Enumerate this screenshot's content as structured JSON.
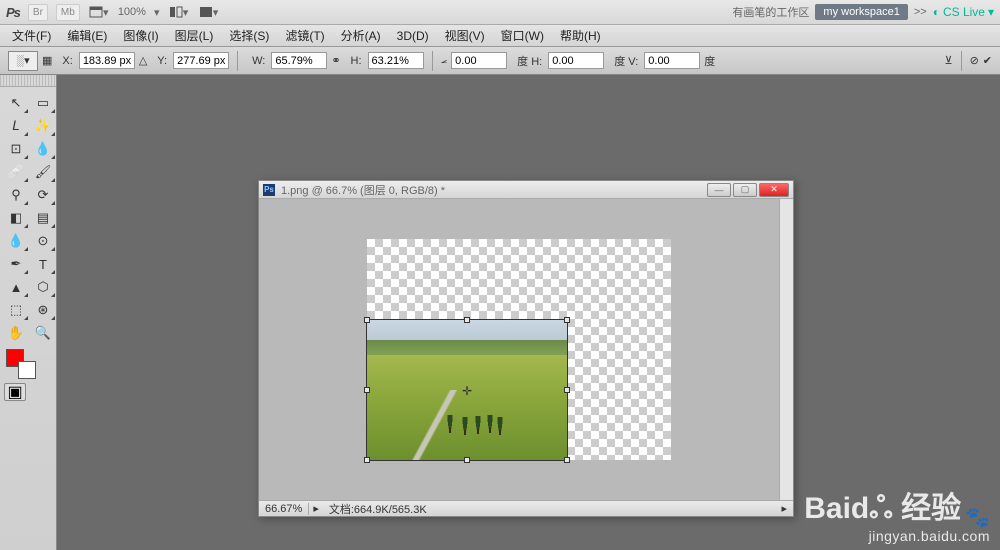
{
  "topbar": {
    "logo": "Ps",
    "buttons": [
      "Br",
      "Mb"
    ],
    "zoom": "100%",
    "workspace_text": "有画笔的工作区",
    "workspace_btn": "my workspace1",
    "nav_arrows": ">>",
    "cslive": "CS Live"
  },
  "menubar": [
    "文件(F)",
    "编辑(E)",
    "图像(I)",
    "图层(L)",
    "选择(S)",
    "滤镜(T)",
    "分析(A)",
    "3D(D)",
    "视图(V)",
    "窗口(W)",
    "帮助(H)"
  ],
  "optbar": {
    "x_label": "X:",
    "x_value": "183.89 px",
    "y_label": "Y:",
    "y_value": "277.69 px",
    "w_label": "W:",
    "w_value": "65.79%",
    "h_label": "H:",
    "h_value": "63.21%",
    "angle_value": "0.00",
    "h2_label": "度   H:",
    "h2_value": "0.00",
    "v_label": "度   V:",
    "v_value": "0.00",
    "v_unit": "度"
  },
  "tools": [
    {
      "name": "move-tool",
      "glyph": "↖",
      "fly": true
    },
    {
      "name": "marquee-tool",
      "glyph": "▭",
      "fly": true
    },
    {
      "name": "lasso-tool",
      "glyph": "𝘓",
      "fly": true
    },
    {
      "name": "wand-tool",
      "glyph": "✨",
      "fly": true
    },
    {
      "name": "crop-tool",
      "glyph": "⊡",
      "fly": true
    },
    {
      "name": "eyedropper-tool",
      "glyph": "💧",
      "fly": true
    },
    {
      "name": "healing-tool",
      "glyph": "🩹",
      "fly": true
    },
    {
      "name": "brush-tool",
      "glyph": "🖌",
      "fly": true
    },
    {
      "name": "stamp-tool",
      "glyph": "⚲",
      "fly": true
    },
    {
      "name": "history-brush-tool",
      "glyph": "⟳",
      "fly": true
    },
    {
      "name": "eraser-tool",
      "glyph": "◧",
      "fly": true
    },
    {
      "name": "gradient-tool",
      "glyph": "▤",
      "fly": true
    },
    {
      "name": "blur-tool",
      "glyph": "💧",
      "fly": true
    },
    {
      "name": "dodge-tool",
      "glyph": "⊙",
      "fly": true
    },
    {
      "name": "pen-tool",
      "glyph": "✒",
      "fly": true
    },
    {
      "name": "type-tool",
      "glyph": "T",
      "fly": true
    },
    {
      "name": "path-select-tool",
      "glyph": "▲",
      "fly": true
    },
    {
      "name": "shape-tool",
      "glyph": "⬡",
      "fly": true
    },
    {
      "name": "3d-tool",
      "glyph": "⬚",
      "fly": true
    },
    {
      "name": "3d-camera-tool",
      "glyph": "⊛",
      "fly": true
    },
    {
      "name": "hand-tool",
      "glyph": "✋",
      "fly": false
    },
    {
      "name": "zoom-tool",
      "glyph": "🔍",
      "fly": false
    }
  ],
  "colors": {
    "fg": "#ff0000",
    "bg": "#ffffff"
  },
  "document": {
    "title": "1.png @ 66.7% (图层 0, RGB/8) *",
    "status_zoom": "66.67%",
    "status_info": "文档:664.9K/565.3K"
  },
  "watermark": {
    "brand": "Baidஃ 经验",
    "url": "jingyan.baidu.com"
  },
  "chart_data": {
    "type": "table",
    "title": "Free Transform state",
    "rows": [
      {
        "field": "X",
        "value": 183.89,
        "unit": "px"
      },
      {
        "field": "Y",
        "value": 277.69,
        "unit": "px"
      },
      {
        "field": "W",
        "value": 65.79,
        "unit": "%"
      },
      {
        "field": "H",
        "value": 63.21,
        "unit": "%"
      },
      {
        "field": "Rotate",
        "value": 0.0,
        "unit": "度"
      },
      {
        "field": "Skew H",
        "value": 0.0,
        "unit": "度"
      },
      {
        "field": "Skew V",
        "value": 0.0,
        "unit": "度"
      },
      {
        "field": "Zoom",
        "value": 66.67,
        "unit": "%"
      }
    ]
  }
}
